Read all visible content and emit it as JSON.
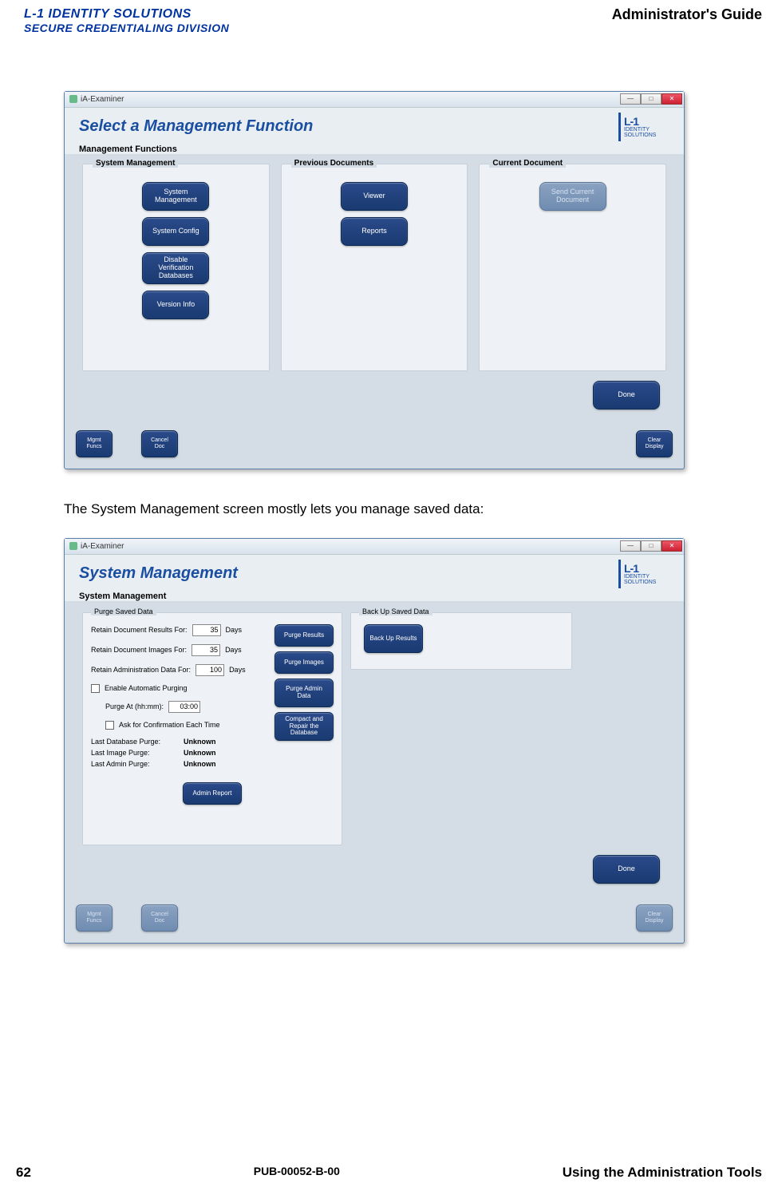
{
  "header": {
    "brand_line1": "L-1 IDENTITY SOLUTIONS",
    "brand_line2": "SECURE CREDENTIALING DIVISION",
    "guide_title": "Administrator's Guide"
  },
  "screen1": {
    "titlebar": "iA-Examiner",
    "app_title": "Select a Management Function",
    "section_label": "Management Functions",
    "logo_text_top": "L-1",
    "logo_text_mid": "IDENTITY",
    "logo_text_bot": "SOLUTIONS",
    "columns": {
      "system": {
        "title": "System Management",
        "buttons": [
          "System Management",
          "System Config",
          "Disable Verification Databases",
          "Version Info"
        ]
      },
      "previous": {
        "title": "Previous Documents",
        "buttons": [
          "Viewer",
          "Reports"
        ]
      },
      "current": {
        "title": "Current Document",
        "buttons": [
          "Send Current Document"
        ]
      }
    },
    "done": "Done",
    "footer": {
      "mgmt": "Mgmt Funcs",
      "cancel": "Cancel Doc",
      "clear": "Clear Display"
    }
  },
  "paragraph": "The System Management screen mostly lets you manage saved data:",
  "screen2": {
    "titlebar": "iA-Examiner",
    "app_title": "System Management",
    "section_label": "System Management",
    "purge": {
      "group_title": "Purge Saved Data",
      "retain_results_label": "Retain Document Results For:",
      "retain_results_value": "35",
      "retain_images_label": "Retain Document Images For:",
      "retain_images_value": "35",
      "retain_admin_label": "Retain Administration Data For:",
      "retain_admin_value": "100",
      "days": "Days",
      "enable_auto": "Enable Automatic Purging",
      "purge_at_label": "Purge At (hh:mm):",
      "purge_at_value": "03:00",
      "ask_confirm": "Ask for Confirmation Each Time",
      "buttons": [
        "Purge Results",
        "Purge Images",
        "Purge Admin Data",
        "Compact and Repair the Database"
      ],
      "status": [
        {
          "label": "Last Database Purge:",
          "value": "Unknown"
        },
        {
          "label": "Last Image Purge:",
          "value": "Unknown"
        },
        {
          "label": "Last Admin Purge:",
          "value": "Unknown"
        }
      ],
      "admin_report": "Admin Report"
    },
    "backup": {
      "group_title": "Back Up Saved Data",
      "button": "Back Up Results"
    },
    "done": "Done",
    "footer": {
      "mgmt": "Mgmt Funcs",
      "cancel": "Cancel Doc",
      "clear": "Clear Display"
    }
  },
  "footer": {
    "page_num": "62",
    "pub": "PUB-00052-B-00",
    "section": "Using the Administration Tools"
  }
}
